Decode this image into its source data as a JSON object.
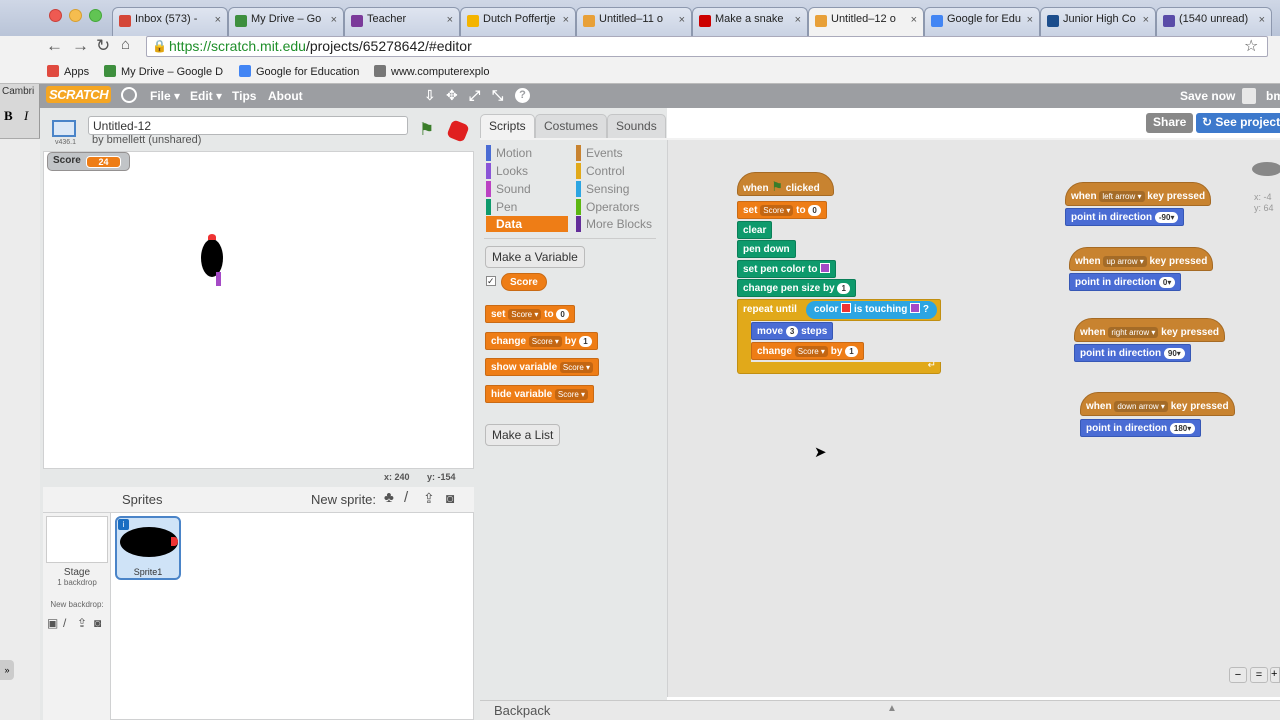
{
  "browser": {
    "tabs": [
      {
        "label": "Inbox (573) -",
        "favicon_color": "#d44638"
      },
      {
        "label": "My Drive – Go",
        "favicon_color": "#3e8f3e"
      },
      {
        "label": "Teacher",
        "favicon_color": "#7b3a9a"
      },
      {
        "label": "Dutch Poffertje",
        "favicon_color": "#f4b400"
      },
      {
        "label": "Untitled–11 o",
        "favicon_color": "#e8a038"
      },
      {
        "label": "Make a snake",
        "favicon_color": "#cc0000"
      },
      {
        "label": "Untitled–12 o",
        "favicon_color": "#e8a038"
      },
      {
        "label": "Google for Edu",
        "favicon_color": "#4285f4"
      },
      {
        "label": "Junior High Co",
        "favicon_color": "#1c4d8c"
      },
      {
        "label": "(1540 unread)",
        "favicon_color": "#5a4ca8"
      }
    ],
    "url_host": "https://scratch.mit.edu",
    "url_path": "/projects/65278642/#editor",
    "bookmarks": [
      {
        "label": "Apps",
        "color": "#e04a3f"
      },
      {
        "label": "My Drive – Google D",
        "color": "#3e8f3e"
      },
      {
        "label": "Google for Education",
        "color": "#4285f4"
      },
      {
        "label": "www.computerexplo",
        "color": "#777777"
      }
    ],
    "left_strip": {
      "font_label": "Cambri",
      "bold": "B",
      "italic": "I"
    }
  },
  "scratch": {
    "logo": "SCRATCH",
    "menus": {
      "file": "File ▾",
      "edit": "Edit ▾",
      "tips": "Tips",
      "about": "About"
    },
    "save_now": "Save now",
    "share": "Share",
    "see_project": "See project",
    "project_title": "Untitled-12",
    "author": "by bmellett (unshared)",
    "version": "v436.1",
    "monitor": {
      "label": "Score",
      "value": "24"
    },
    "mouse_x": "x: 240",
    "mouse_y": "y: -154",
    "sprites_title": "Sprites",
    "new_sprite": "New sprite:",
    "stage_label": "Stage",
    "stage_backdrops": "1 backdrop",
    "new_backdrop": "New backdrop:",
    "sprite1": "Sprite1",
    "backpack": "Backpack",
    "xy_readout_x": "x: -4",
    "xy_readout_y": "y: 64"
  },
  "palette": {
    "tabs": {
      "scripts": "Scripts",
      "costumes": "Costumes",
      "sounds": "Sounds"
    },
    "categories_left": [
      {
        "label": "Motion",
        "color": "#4a6cd4"
      },
      {
        "label": "Looks",
        "color": "#8a55d7"
      },
      {
        "label": "Sound",
        "color": "#bb42c3"
      },
      {
        "label": "Pen",
        "color": "#0e9a6c"
      },
      {
        "label": "Data",
        "color": "#ee7d16"
      }
    ],
    "categories_right": [
      {
        "label": "Events",
        "color": "#c88330"
      },
      {
        "label": "Control",
        "color": "#e1a91a"
      },
      {
        "label": "Sensing",
        "color": "#2ca5e2"
      },
      {
        "label": "Operators",
        "color": "#5cb712"
      },
      {
        "label": "More Blocks",
        "color": "#632d99"
      }
    ],
    "make_variable": "Make a Variable",
    "variable_name": "Score",
    "block_set": "set",
    "block_to": "to",
    "block_change": "change",
    "block_by": "by",
    "block_show": "show variable",
    "block_hide": "hide variable",
    "val_0": "0",
    "val_1": "1",
    "make_list": "Make a List"
  },
  "scripts": {
    "when": "when",
    "clicked": "clicked",
    "set": "set",
    "to": "to",
    "score": "Score",
    "zero": "0",
    "clear": "clear",
    "pen_down": "pen down",
    "set_pen_color_to": "set pen color to",
    "change_pen_size_by": "change pen size by",
    "one": "1",
    "repeat_until": "repeat until",
    "color": "color",
    "is_touching": "is touching",
    "q": "?",
    "move": "move",
    "three": "3",
    "steps": "steps",
    "change": "change",
    "by": "by",
    "key_pressed": "key pressed",
    "point_in_direction": "point in direction",
    "left_arrow": "left arrow",
    "up_arrow": "up arrow",
    "right_arrow": "right arrow",
    "down_arrow": "down arrow",
    "dir_left": "-90",
    "dir_up": "0",
    "dir_right": "90",
    "dir_down": "180"
  }
}
